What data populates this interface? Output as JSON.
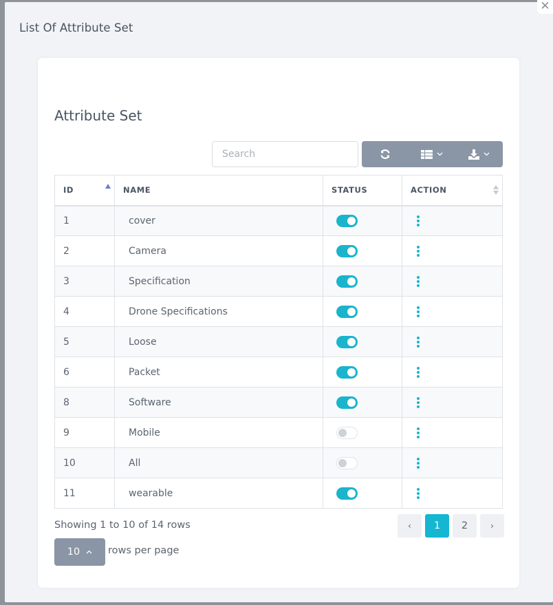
{
  "modal": {
    "title": "List Of Attribute Set",
    "close_icon": "close-icon"
  },
  "card": {
    "title": "Attribute Set"
  },
  "search": {
    "placeholder": "Search",
    "value": ""
  },
  "toolbar": {
    "refresh_icon": "refresh-icon",
    "columns_icon": "columns-list-icon",
    "export_icon": "download-icon"
  },
  "table": {
    "headers": {
      "id": "ID",
      "name": "NAME",
      "status": "STATUS",
      "action": "ACTION"
    },
    "rows": [
      {
        "id": "1",
        "name": "cover",
        "status": true
      },
      {
        "id": "2",
        "name": "Camera",
        "status": true
      },
      {
        "id": "3",
        "name": "Specification",
        "status": true
      },
      {
        "id": "4",
        "name": "Drone Specifications",
        "status": true
      },
      {
        "id": "5",
        "name": "Loose",
        "status": true
      },
      {
        "id": "6",
        "name": "Packet",
        "status": true
      },
      {
        "id": "8",
        "name": "Software",
        "status": true
      },
      {
        "id": "9",
        "name": "Mobile",
        "status": false
      },
      {
        "id": "10",
        "name": "All",
        "status": false
      },
      {
        "id": "11",
        "name": "wearable",
        "status": true
      }
    ]
  },
  "footer": {
    "showing": "Showing 1 to 10 of 14 rows",
    "rows_per_page_value": "10",
    "rows_per_page_label": "rows per page"
  },
  "pagination": {
    "prev": "‹",
    "pages": [
      "1",
      "2"
    ],
    "current": "1",
    "next": "›"
  },
  "colors": {
    "accent": "#1ab4cd",
    "toolbar": "#8a95a5"
  }
}
